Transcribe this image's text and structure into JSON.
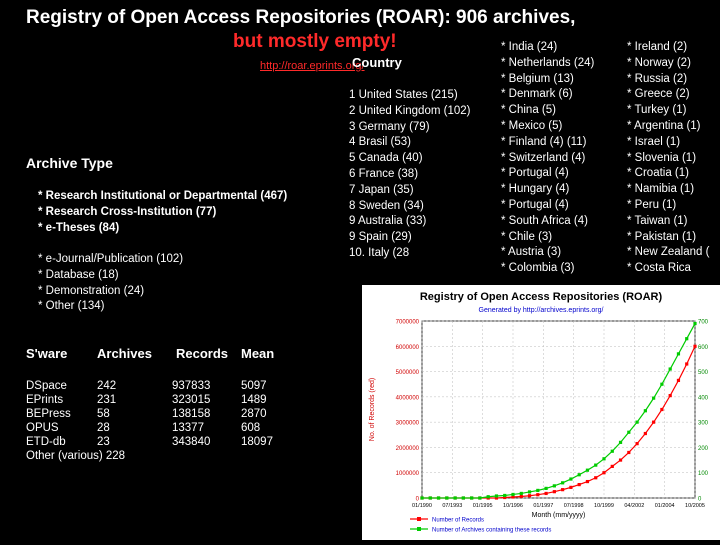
{
  "header": {
    "title_line1": "Registry of Open Access Repositories (ROAR):  906 archives,",
    "title_line2": "but mostly empty!",
    "url": "http://roar.eprints.org/",
    "country_heading": "Country"
  },
  "top_countries": [
    "1 United States (215)",
    "2 United Kingdom (102)",
    "3 Germany (79)",
    "4 Brasil (53)",
    "5 Canada (40)",
    "6 France (38)",
    "7 Japan (35)",
    "8 Sweden (34)",
    "9 Australia (33)",
    "9 Spain  (29)",
    "10.  Italy (28"
  ],
  "countries_col2": [
    "* India (24)",
    "*  Netherlands (24)",
    "* Belgium (13)",
    "* Denmark (6)",
    "* China (5)",
    "* Mexico (5)",
    "* Finland (4) (11)",
    "* Switzerland (4)",
    "* Portugal (4)",
    "* Hungary (4)",
    "* Portugal (4)",
    "* South Africa (4)",
    "* Chile (3)",
    "* Austria (3)",
    "* Colombia (3)"
  ],
  "countries_col3": [
    "* Ireland (2)",
    "* Norway (2)",
    "* Russia (2)",
    "* Greece (2)",
    "* Turkey (1)",
    "* Argentina (1)",
    "* Israel (1)",
    "* Slovenia (1)",
    "* Croatia (1)",
    "* Namibia (1)",
    "* Peru (1)",
    "* Taiwan (1)",
    "* Pakistan (1)",
    "* New Zealand (",
    "* Costa Rica"
  ],
  "archive_type": {
    "heading": "Archive Type",
    "bold_items": [
      "* Research Institutional or Departmental (467)",
      "* Research Cross-Institution (77)",
      "* e-Theses (84)"
    ],
    "items": [
      "* e-Journal/Publication (102)",
      "* Database (18)",
      "* Demonstration (24)",
      "* Other (134)"
    ]
  },
  "software_table": {
    "headers": [
      "S'ware",
      "Archives",
      "Records",
      "Mean"
    ],
    "rows": [
      [
        "DSpace",
        "242",
        "937833",
        "5097"
      ],
      [
        "EPrints",
        "231",
        "323015",
        "1489"
      ],
      [
        "BEPress",
        "58",
        "138158",
        "2870"
      ],
      [
        "OPUS",
        "28",
        "13377",
        "608"
      ],
      [
        "ETD-db",
        "23",
        "343840",
        "18097"
      ]
    ],
    "other_row": "Other (various) 228"
  },
  "chart_data": {
    "type": "line",
    "title": "Registry of Open Access Repositories (ROAR)",
    "subtitle": "Generated by http://archives.eprints.org/",
    "xlabel": "Month (mm/yyyy)",
    "ylabel": "No. of Records (red)",
    "y2label": "No. of Archives (green)",
    "x_ticks": [
      "01/1990",
      "07/1993",
      "01/1995",
      "10/1996",
      "01/1997",
      "07/1998",
      "10/1999",
      "04/2002",
      "01/2004",
      "10/2005"
    ],
    "ylim": [
      0,
      7000000
    ],
    "y_ticks": [
      "0",
      "1000000",
      "2000000",
      "3000000",
      "4000000",
      "5000000",
      "6000000",
      "7000000"
    ],
    "y2lim": [
      0,
      700
    ],
    "y2_ticks": [
      "0",
      "100",
      "200",
      "300",
      "400",
      "500",
      "600",
      "700"
    ],
    "grid": true,
    "legend": "bottom-left",
    "series": [
      {
        "name": "Number of Records",
        "color": "#ff0000",
        "axis": "left",
        "values": [
          0,
          0,
          0,
          0,
          0,
          0,
          0,
          0,
          0,
          0,
          20000,
          40000,
          60000,
          90000,
          130000,
          180000,
          250000,
          330000,
          420000,
          530000,
          650000,
          800000,
          1000000,
          1250000,
          1500000,
          1800000,
          2150000,
          2550000,
          3000000,
          3500000,
          4050000,
          4650000,
          5300000,
          6000000
        ]
      },
      {
        "name": "Number of Archives containing these records",
        "color": "#00cc00",
        "axis": "right",
        "values": [
          0,
          0,
          0,
          0,
          0,
          0,
          0,
          0,
          5,
          8,
          10,
          14,
          18,
          24,
          30,
          38,
          48,
          60,
          75,
          92,
          110,
          130,
          155,
          185,
          220,
          260,
          300,
          345,
          395,
          450,
          510,
          570,
          630,
          690
        ]
      }
    ]
  }
}
